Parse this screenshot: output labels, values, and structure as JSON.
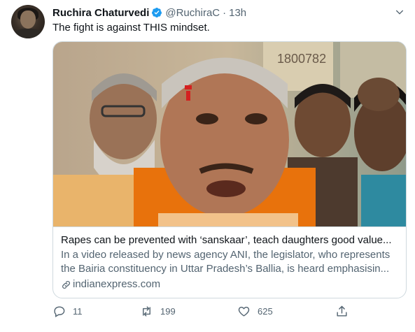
{
  "tweet": {
    "display_name": "Ruchira Chaturvedi",
    "handle": "@RuchiraC",
    "separator": "·",
    "time": "13h",
    "text": "The fight is against THIS mindset."
  },
  "card": {
    "title": "Rapes can be prevented with ‘sanskaar’, teach daughters good value...",
    "description_lines": [
      "In a video released by news agency ANI, the legislator, who represents",
      "the Bairia constituency in Uttar Pradesh’s Ballia, is heard emphasisin..."
    ],
    "domain": "indianexpress.com",
    "image_wall_text": "1800782"
  },
  "actions": {
    "replies": "11",
    "retweets": "199",
    "likes": "625"
  },
  "colors": {
    "verified_blue": "#1d9bf0",
    "secondary_text": "#536471",
    "border": "#cfd9de"
  },
  "icons": {
    "verified": "verified-badge-icon",
    "more": "chevron-down-icon",
    "reply": "reply-icon",
    "retweet": "retweet-icon",
    "like": "heart-icon",
    "share": "share-icon",
    "link": "link-icon"
  }
}
